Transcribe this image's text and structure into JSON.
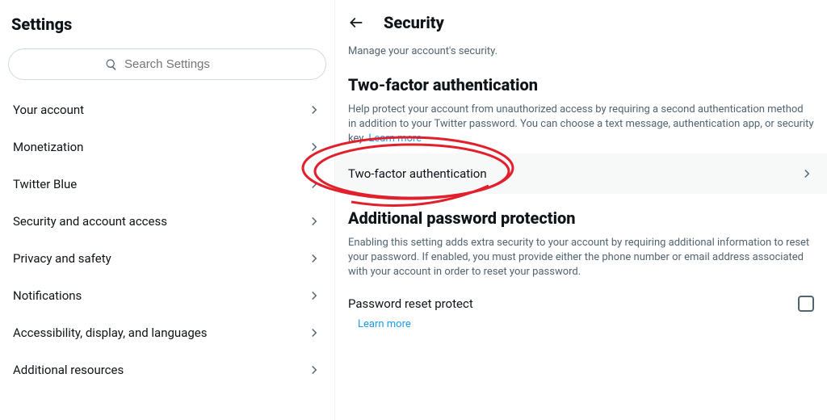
{
  "sidebar": {
    "title": "Settings",
    "search_placeholder": "Search Settings",
    "items": [
      {
        "label": "Your account"
      },
      {
        "label": "Monetization"
      },
      {
        "label": "Twitter Blue"
      },
      {
        "label": "Security and account access"
      },
      {
        "label": "Privacy and safety"
      },
      {
        "label": "Notifications"
      },
      {
        "label": "Accessibility, display, and languages"
      },
      {
        "label": "Additional resources"
      }
    ]
  },
  "main": {
    "title": "Security",
    "subtitle": "Manage your account's security.",
    "twofa": {
      "heading": "Two-factor authentication",
      "desc": "Help protect your account from unauthorized access by requiring a second authentication method in addition to your Twitter password. You can choose a text message, authentication app, or security key. ",
      "learn_more": "Learn more",
      "row_label": "Two-factor authentication"
    },
    "additional": {
      "heading": "Additional password protection",
      "desc": "Enabling this setting adds extra security to your account by requiring additional information to reset your password. If enabled, you must provide either the phone number or email address associated with your account in order to reset your password.",
      "protect_label": "Password reset protect",
      "learn_more": "Learn more"
    }
  }
}
